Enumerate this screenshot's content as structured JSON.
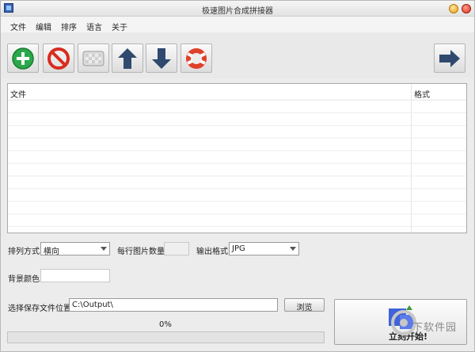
{
  "window": {
    "title": "极速图片合成拼接器"
  },
  "menu": {
    "items": [
      "文件",
      "编辑",
      "排序",
      "语言",
      "关于"
    ]
  },
  "toolbar": {
    "buttons": [
      {
        "icon": "add-icon"
      },
      {
        "icon": "remove-icon"
      },
      {
        "icon": "clear-icon"
      },
      {
        "icon": "move-up-icon"
      },
      {
        "icon": "move-down-icon"
      },
      {
        "icon": "help-icon"
      }
    ],
    "next_icon": "arrow-right-icon"
  },
  "file_list": {
    "col_file": "文件",
    "col_format": "格式",
    "rows": []
  },
  "options": {
    "arrange_label": "排列方式",
    "arrange_value": "横向",
    "per_row_label": "每行图片数量",
    "per_row_value": "",
    "format_label": "输出格式",
    "format_value": "JPG",
    "bg_label": "背景颜色",
    "bg_value": ""
  },
  "output": {
    "path_label": "选择保存文件位置",
    "path_value": "C:\\Output\\",
    "browse_label": "浏览"
  },
  "progress": {
    "text": "0%",
    "value": 0
  },
  "start": {
    "label": "立刻开始!"
  },
  "watermark": {
    "text": "下软件园"
  },
  "colors": {
    "add": "#2aa84a",
    "remove": "#d92b1e",
    "arrow": "#2f4a6e",
    "help": "#e0402a"
  }
}
